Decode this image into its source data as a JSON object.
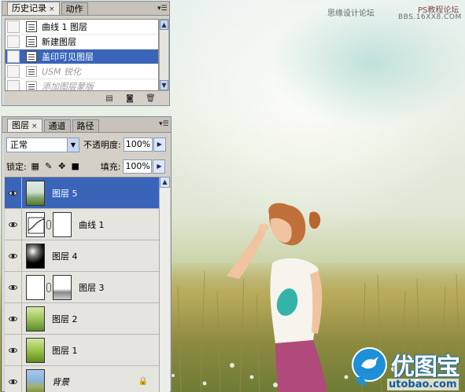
{
  "history_panel": {
    "tabs": [
      {
        "label": "历史记录",
        "active": true,
        "close": "×"
      },
      {
        "label": "动作",
        "active": false
      }
    ],
    "menu_glyph": "▾☰",
    "items": [
      {
        "label": "曲线 1 图层",
        "state": "normal"
      },
      {
        "label": "新建图层",
        "state": "normal"
      },
      {
        "label": "盖印可见图层",
        "state": "selected"
      },
      {
        "label": "USM 锐化",
        "state": "dimmed"
      },
      {
        "label": "添加图层蒙版",
        "state": "dimmed"
      }
    ],
    "bottom_icons": [
      "new-document-from-state-icon",
      "snapshot-camera-icon",
      "trash-icon"
    ]
  },
  "layers_panel": {
    "tabs": [
      {
        "label": "图层",
        "active": true,
        "close": "×"
      },
      {
        "label": "通道",
        "active": false
      },
      {
        "label": "路径",
        "active": false
      }
    ],
    "blend_mode": "正常",
    "opacity_label": "不透明度:",
    "opacity_value": "100%",
    "lock_label": "锁定:",
    "fill_label": "填充:",
    "fill_value": "100%",
    "layers": [
      {
        "name": "图层 5",
        "selected": true,
        "thumb": "t-photo",
        "mask": null
      },
      {
        "name": "曲线 1",
        "selected": false,
        "thumb": "t-curve",
        "mask": "t-white"
      },
      {
        "name": "图层 4",
        "selected": false,
        "thumb": "t-dark",
        "mask": null
      },
      {
        "name": "图层 3",
        "selected": false,
        "thumb": "t-white",
        "mask": "t-mask3"
      },
      {
        "name": "图层 2",
        "selected": false,
        "thumb": "t-green",
        "mask": null
      },
      {
        "name": "图层 1",
        "selected": false,
        "thumb": "t-green2",
        "mask": null
      },
      {
        "name": "背景",
        "selected": false,
        "thumb": "t-bg",
        "mask": null,
        "locked": true
      }
    ]
  },
  "watermarks": {
    "site": "思缘设计论坛",
    "ps_forum": "PS教程论坛",
    "bbs_url": "BBS.16XX8.COM"
  },
  "logo": {
    "name": "优图宝",
    "url": "utobao.com",
    "color": "#1e90d8"
  }
}
